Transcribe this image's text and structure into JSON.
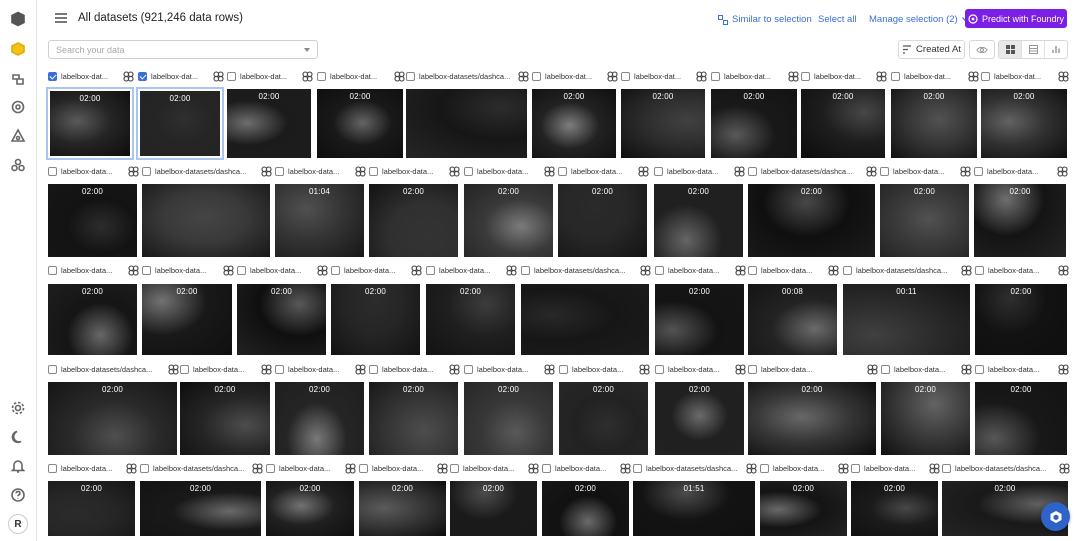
{
  "header": {
    "title": "All datasets (921,246 data rows)",
    "similar_label": "Similar to selection",
    "select_all_label": "Select all",
    "manage_label": "Manage selection (2)",
    "predict_label": "Predict with Foundry"
  },
  "toolbar": {
    "search_placeholder": "Search your data",
    "sort_label": "Created At"
  },
  "rail": {
    "icons": [
      "cube-icon",
      "labelbox-logo-icon",
      "catalog-icon",
      "annotate-icon",
      "model-icon",
      "workflow-icon",
      "settings-icon",
      "dark-mode-icon",
      "notifications-icon",
      "help-icon"
    ],
    "avatar": "R"
  },
  "colors": {
    "accent": "#3a6fd8",
    "predict": "#7b1fe6",
    "selection": "#a8c6f0"
  },
  "rows": [
    {
      "items": [
        {
          "caption": "labelbox-dat...",
          "checked": true,
          "duration": "02:00",
          "selected": true
        },
        {
          "caption": "labelbox-dat...",
          "checked": true,
          "duration": "02:00",
          "selected": true
        },
        {
          "caption": "labelbox-dat...",
          "checked": false,
          "duration": "02:00"
        },
        {
          "caption": "labelbox-dat...",
          "checked": false,
          "duration": "02:00"
        },
        {
          "caption": "labelbox-datasets/dashca...",
          "checked": false,
          "duration": ""
        },
        {
          "caption": "labelbox-dat...",
          "checked": false,
          "duration": "02:00"
        },
        {
          "caption": "labelbox-dat...",
          "checked": false,
          "duration": "02:00"
        },
        {
          "caption": "labelbox-dat...",
          "checked": false,
          "duration": "02:00"
        },
        {
          "caption": "labelbox-dat...",
          "checked": false,
          "duration": "02:00"
        },
        {
          "caption": "labelbox-dat...",
          "checked": false,
          "duration": "02:00"
        },
        {
          "caption": "labelbox-dat...",
          "checked": false,
          "duration": "02:00"
        }
      ]
    },
    {
      "items": [
        {
          "caption": "labelbox-data...",
          "checked": false,
          "duration": "02:00"
        },
        {
          "caption": "labelbox-datasets/dashca...",
          "checked": false,
          "duration": ""
        },
        {
          "caption": "labelbox-data...",
          "checked": false,
          "duration": "01:04"
        },
        {
          "caption": "labelbox-data...",
          "checked": false,
          "duration": "02:00"
        },
        {
          "caption": "labelbox-data...",
          "checked": false,
          "duration": "02:00"
        },
        {
          "caption": "labelbox-data...",
          "checked": false,
          "duration": "02:00"
        },
        {
          "caption": "labelbox-data...",
          "checked": false,
          "duration": "02:00"
        },
        {
          "caption": "labelbox-datasets/dashca...",
          "checked": false,
          "duration": "02:00"
        },
        {
          "caption": "labelbox-data...",
          "checked": false,
          "duration": "02:00"
        },
        {
          "caption": "labelbox-data...",
          "checked": false,
          "duration": "02:00"
        }
      ]
    },
    {
      "items": [
        {
          "caption": "labelbox-data...",
          "checked": false,
          "duration": "02:00"
        },
        {
          "caption": "labelbox-data...",
          "checked": false,
          "duration": "02:00"
        },
        {
          "caption": "labelbox-data...",
          "checked": false,
          "duration": "02:00"
        },
        {
          "caption": "labelbox-data...",
          "checked": false,
          "duration": "02:00"
        },
        {
          "caption": "labelbox-data...",
          "checked": false,
          "duration": "02:00"
        },
        {
          "caption": "labelbox-datasets/dashca...",
          "checked": false,
          "duration": ""
        },
        {
          "caption": "labelbox-data...",
          "checked": false,
          "duration": "02:00"
        },
        {
          "caption": "labelbox-data...",
          "checked": false,
          "duration": "00:08"
        },
        {
          "caption": "labelbox-datasets/dashca...",
          "checked": false,
          "duration": "00:11"
        },
        {
          "caption": "labelbox-data...",
          "checked": false,
          "duration": "02:00"
        }
      ]
    },
    {
      "items": [
        {
          "caption": "labelbox-datasets/dashca...",
          "checked": false,
          "duration": "02:00"
        },
        {
          "caption": "labelbox-data...",
          "checked": false,
          "duration": "02:00"
        },
        {
          "caption": "labelbox-data...",
          "checked": false,
          "duration": "02:00"
        },
        {
          "caption": "labelbox-data...",
          "checked": false,
          "duration": "02:00"
        },
        {
          "caption": "labelbox-data...",
          "checked": false,
          "duration": "02:00"
        },
        {
          "caption": "labelbox-data...",
          "checked": false,
          "duration": "02:00"
        },
        {
          "caption": "labelbox-data...",
          "checked": false,
          "duration": "02:00"
        },
        {
          "caption": "labelbox-data...",
          "checked": false,
          "duration": "02:00"
        },
        {
          "caption": "labelbox-data...",
          "checked": false,
          "duration": "02:00"
        },
        {
          "caption": "labelbox-data...",
          "checked": false,
          "duration": "02:00"
        }
      ]
    },
    {
      "items": [
        {
          "caption": "labelbox-data...",
          "checked": false,
          "duration": "02:00"
        },
        {
          "caption": "labelbox-datasets/dashca...",
          "checked": false,
          "duration": "02:00"
        },
        {
          "caption": "labelbox-data...",
          "checked": false,
          "duration": "02:00"
        },
        {
          "caption": "labelbox-data...",
          "checked": false,
          "duration": "02:00"
        },
        {
          "caption": "labelbox-data...",
          "checked": false,
          "duration": "02:00"
        },
        {
          "caption": "labelbox-data...",
          "checked": false,
          "duration": "02:00"
        },
        {
          "caption": "labelbox-datasets/dashca...",
          "checked": false,
          "duration": "01:51"
        },
        {
          "caption": "labelbox-data...",
          "checked": false,
          "duration": "02:00"
        },
        {
          "caption": "labelbox-data...",
          "checked": false,
          "duration": "02:00"
        },
        {
          "caption": "labelbox-datasets/dashca...",
          "checked": false,
          "duration": "02:00"
        }
      ]
    }
  ]
}
